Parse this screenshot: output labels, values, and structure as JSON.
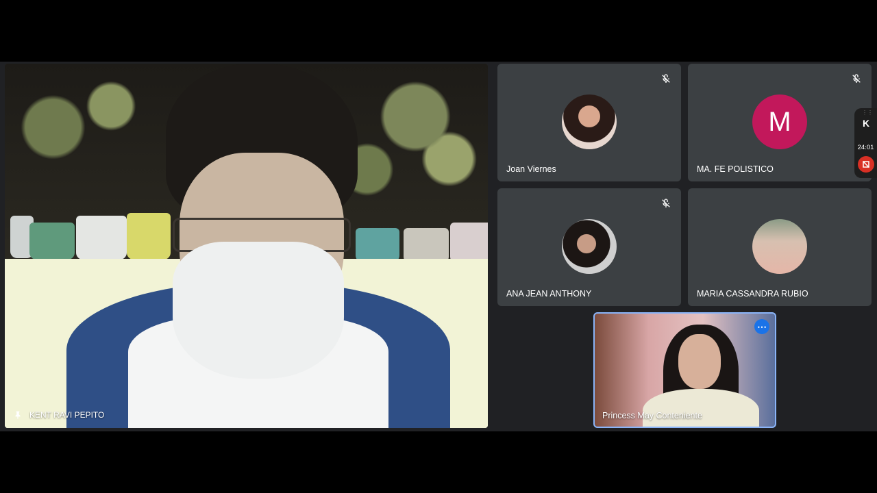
{
  "main_speaker": {
    "name": "KENT RAVI PEPITO",
    "icon": "pin-icon"
  },
  "participants": [
    {
      "name": "Joan Viernes",
      "muted": true,
      "avatar_type": "photo"
    },
    {
      "name": "MA. FE POLISTICO",
      "muted": true,
      "avatar_type": "letter",
      "avatar_letter": "M",
      "avatar_color": "#c2185b"
    },
    {
      "name": "ANA JEAN ANTHONY",
      "muted": true,
      "avatar_type": "photo"
    },
    {
      "name": "MARIA CASSANDRA RUBIO",
      "muted": false,
      "avatar_type": "photo"
    }
  ],
  "self_view": {
    "name": "Princess May Conteniente",
    "more_icon": "more-options-icon",
    "border_color": "#8ab4f8"
  },
  "side_widget": {
    "timer": "24:01",
    "logo_letter": "K"
  },
  "colors": {
    "tile_bg": "#3c4043",
    "stage_bg": "#202124",
    "accent": "#1a73e8",
    "stop": "#d93025"
  }
}
